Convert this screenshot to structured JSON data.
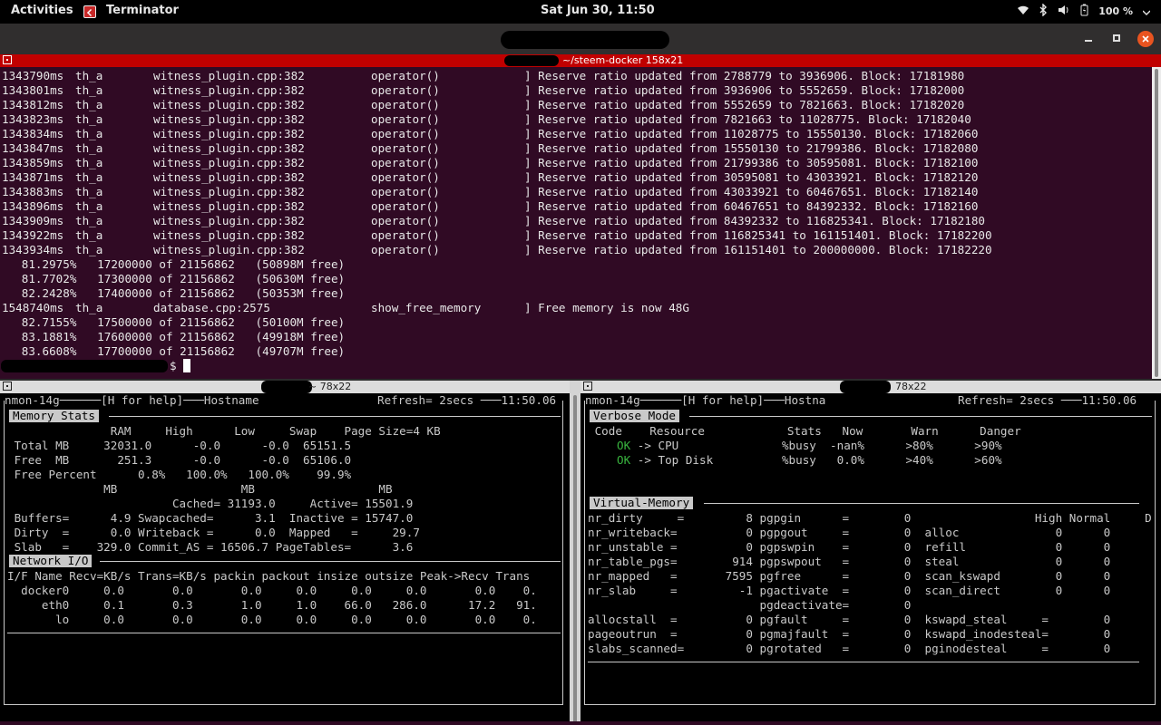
{
  "topbar": {
    "activities": "Activities",
    "app_name": "Terminator",
    "clock": "Sat Jun 30, 11:50",
    "battery": "100 %",
    "icons": [
      "wifi-icon",
      "bluetooth-icon",
      "volume-icon",
      "battery-icon"
    ]
  },
  "window": {
    "buttons": [
      "minimize",
      "maximize",
      "close"
    ]
  },
  "top_pane": {
    "title": "~/steem-docker 158x21",
    "log_rows": [
      {
        "ts": "1343790ms",
        "th": "th_a",
        "file": "witness_plugin.cpp:382",
        "fn": "operator()",
        "msg": "] Reserve ratio updated from 2788779 to 3936906. Block: 17181980"
      },
      {
        "ts": "1343801ms",
        "th": "th_a",
        "file": "witness_plugin.cpp:382",
        "fn": "operator()",
        "msg": "] Reserve ratio updated from 3936906 to 5552659. Block: 17182000"
      },
      {
        "ts": "1343812ms",
        "th": "th_a",
        "file": "witness_plugin.cpp:382",
        "fn": "operator()",
        "msg": "] Reserve ratio updated from 5552659 to 7821663. Block: 17182020"
      },
      {
        "ts": "1343823ms",
        "th": "th_a",
        "file": "witness_plugin.cpp:382",
        "fn": "operator()",
        "msg": "] Reserve ratio updated from 7821663 to 11028775. Block: 17182040"
      },
      {
        "ts": "1343834ms",
        "th": "th_a",
        "file": "witness_plugin.cpp:382",
        "fn": "operator()",
        "msg": "] Reserve ratio updated from 11028775 to 15550130. Block: 17182060"
      },
      {
        "ts": "1343847ms",
        "th": "th_a",
        "file": "witness_plugin.cpp:382",
        "fn": "operator()",
        "msg": "] Reserve ratio updated from 15550130 to 21799386. Block: 17182080"
      },
      {
        "ts": "1343859ms",
        "th": "th_a",
        "file": "witness_plugin.cpp:382",
        "fn": "operator()",
        "msg": "] Reserve ratio updated from 21799386 to 30595081. Block: 17182100"
      },
      {
        "ts": "1343871ms",
        "th": "th_a",
        "file": "witness_plugin.cpp:382",
        "fn": "operator()",
        "msg": "] Reserve ratio updated from 30595081 to 43033921. Block: 17182120"
      },
      {
        "ts": "1343883ms",
        "th": "th_a",
        "file": "witness_plugin.cpp:382",
        "fn": "operator()",
        "msg": "] Reserve ratio updated from 43033921 to 60467651. Block: 17182140"
      },
      {
        "ts": "1343896ms",
        "th": "th_a",
        "file": "witness_plugin.cpp:382",
        "fn": "operator()",
        "msg": "] Reserve ratio updated from 60467651 to 84392332. Block: 17182160"
      },
      {
        "ts": "1343909ms",
        "th": "th_a",
        "file": "witness_plugin.cpp:382",
        "fn": "operator()",
        "msg": "] Reserve ratio updated from 84392332 to 116825341. Block: 17182180"
      },
      {
        "ts": "1343922ms",
        "th": "th_a",
        "file": "witness_plugin.cpp:382",
        "fn": "operator()",
        "msg": "] Reserve ratio updated from 116825341 to 161151401. Block: 17182200"
      },
      {
        "ts": "1343934ms",
        "th": "th_a",
        "file": "witness_plugin.cpp:382",
        "fn": "operator()",
        "msg": "] Reserve ratio updated from 161151401 to 200000000. Block: 17182220"
      }
    ],
    "progress_a": [
      "   81.2975%   17200000 of 21156862   (50898M free)",
      "   81.7702%   17300000 of 21156862   (50630M free)",
      "   82.2428%   17400000 of 21156862   (50353M free)"
    ],
    "memory_row": {
      "ts": "1548740ms",
      "th": "th_a",
      "file": "database.cpp:2575",
      "fn": "show_free_memory",
      "msg": "] Free memory is now 48G"
    },
    "progress_b": [
      "   82.7155%   17500000 of 21156862   (50100M free)",
      "   83.1881%   17600000 of 21156862   (49918M free)",
      "   83.6608%   17700000 of 21156862   (49707M free)"
    ],
    "prompt": "$"
  },
  "left_pane": {
    "title": "~ 78x22",
    "header": "nmon-14g──────[H for help]───Hostname",
    "refresh": "Refresh= 2secs ───11:50.06",
    "memory_title": "Memory Stats",
    "memory_rows": [
      "               RAM     High      Low     Swap    Page Size=4 KB",
      " Total MB     32031.0      -0.0      -0.0  65151.5",
      " Free  MB       251.3      -0.0      -0.0  65106.0",
      " Free Percent      0.8%   100.0%   100.0%    99.9%",
      "              MB                  MB                  MB",
      "                        Cached= 31193.0     Active= 15501.9",
      " Buffers=      4.9 Swapcached=      3.1  Inactive = 15747.0",
      " Dirty  =      0.0 Writeback =      0.0  Mapped   =     29.7",
      " Slab   =    329.0 Commit_AS = 16506.7 PageTables=      3.6"
    ],
    "network_title": "Network I/O",
    "network_rows": [
      "I/F Name Recv=KB/s Trans=KB/s packin packout insize outsize Peak->Recv Trans",
      "  docker0     0.0       0.0       0.0     0.0     0.0     0.0       0.0    0.",
      "     eth0     0.1       0.3       1.0     1.0    66.0   286.0      17.2   91.",
      "       lo     0.0       0.0       0.0     0.0     0.0     0.0       0.0    0."
    ]
  },
  "right_pane": {
    "title": "78x22",
    "header": "nmon-14g──────[H for help]───Hostna",
    "refresh": "Refresh= 2secs ───11:50.06",
    "verbose_title": "Verbose Mode",
    "verbose_header": " Code    Resource            Stats   Now       Warn      Danger",
    "verbose_rows": [
      {
        "ok": "OK",
        "rest": " -> CPU               %busy  -nan%      >80%      >90%"
      },
      {
        "ok": "OK",
        "rest": " -> Top Disk          %busy   0.0%      >40%      >60%"
      }
    ],
    "vm_title": "Virtual-Memory",
    "vm_rows": [
      "nr_dirty     =         8 pgpgin      =        0                  High Normal     D",
      "nr_writeback=          0 pgpgout     =        0  alloc              0      0",
      "nr_unstable =          0 pgpswpin    =        0  refill             0      0",
      "nr_table_pgs=        914 pgpswpout   =        0  steal              0      0",
      "nr_mapped   =       7595 pgfree      =        0  scan_kswapd        0      0",
      "nr_slab     =         -1 pgactivate  =        0  scan_direct        0      0",
      "                         pgdeactivate=        0",
      "allocstall  =          0 pgfault     =        0  kswapd_steal     =        0",
      "pageoutrun  =          0 pgmajfault  =        0  kswapd_inodesteal=        0",
      "slabs_scanned=         0 pgrotated   =        0  pginodesteal     =        0"
    ]
  }
}
